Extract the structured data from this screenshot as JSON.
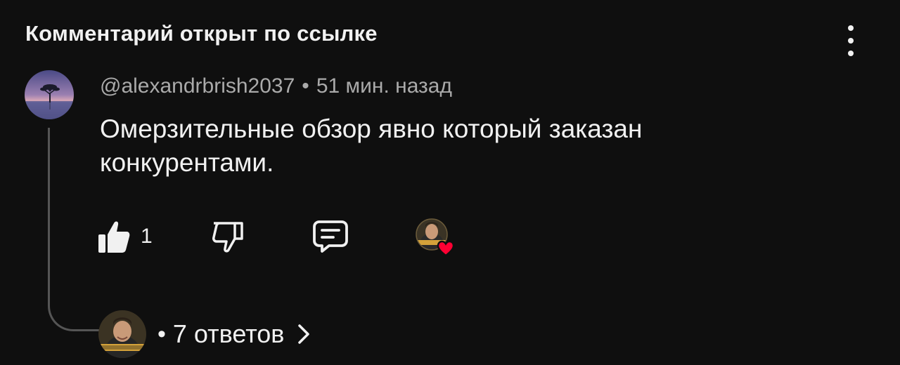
{
  "header": {
    "title": "Комментарий открыт по ссылке",
    "menu_icon": "kebab-menu-icon"
  },
  "comment": {
    "author": "@alexandrbrish2037",
    "separator": "•",
    "time": "51 мин. назад",
    "text": "Омерзительные обзор явно который заказан конкурентами.",
    "likes": "1",
    "avatar_icon": "avatar-tree-sunset"
  },
  "actions": {
    "like_icon": "thumbs-up-icon",
    "dislike_icon": "thumbs-down-icon",
    "reply_icon": "reply-comment-icon",
    "creator_heart_icon": "creator-heart-icon"
  },
  "replies": {
    "separator": "•",
    "label": "7 ответов",
    "chevron_icon": "chevron-right-icon"
  },
  "colors": {
    "background": "#0f0f0f",
    "text": "#f1f1f1",
    "muted": "#aaaaaa",
    "heart": "#ff0033"
  }
}
